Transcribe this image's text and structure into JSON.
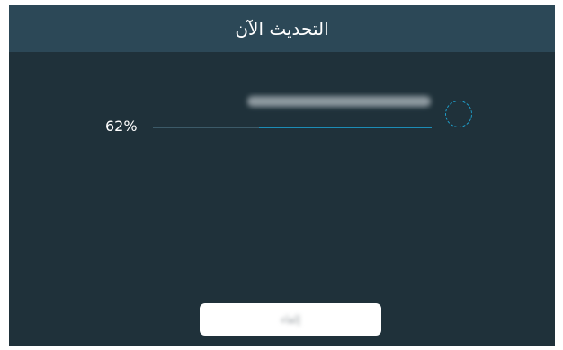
{
  "header": {
    "title": "التحديث الآن"
  },
  "progress": {
    "percent_label": "62%",
    "fraction": 0.62
  },
  "status": {
    "message": ""
  },
  "buttons": {
    "cancel_label": "إلغاء"
  },
  "colors": {
    "frame_bg": "#1f313a",
    "header_bg": "#2c4857",
    "accent": "#1c8cb6"
  }
}
